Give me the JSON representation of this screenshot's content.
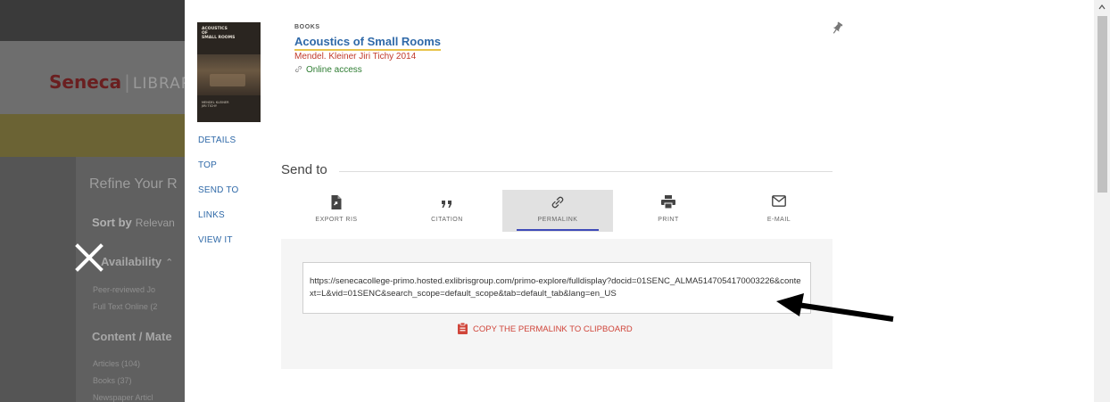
{
  "background": {
    "logo": {
      "brand": "Seneca",
      "separator": "|",
      "library": "LIBRARI"
    },
    "refine_heading": "Refine Your R",
    "sort": {
      "label": "Sort by",
      "value": "Relevan"
    },
    "availability": {
      "heading": "Availability",
      "items": [
        "Peer-reviewed Jo",
        "Full Text Online (2"
      ]
    },
    "content_type": {
      "heading": "Content / Mate",
      "items": [
        "Articles (104)",
        "Books (37)",
        "Newspaper Articl"
      ]
    },
    "close_label": "×"
  },
  "record": {
    "cover": {
      "title_lines": [
        "ACOUSTICS",
        "OF",
        "SMALL ROOMS"
      ],
      "author_lines": [
        "MENDEL KLEINER",
        "JIRI TICHY"
      ]
    },
    "type": "BOOKS",
    "title": "Acoustics of Small Rooms",
    "author_line": "Mendel. Kleiner Jiri Tichy 2014",
    "access": "Online access",
    "side_nav": [
      "DETAILS",
      "TOP",
      "SEND TO",
      "LINKS",
      "VIEW IT"
    ]
  },
  "send_to": {
    "heading": "Send to",
    "tabs": [
      {
        "label": "EXPORT RIS",
        "icon": "export-ris-icon"
      },
      {
        "label": "CITATION",
        "icon": "quote-icon"
      },
      {
        "label": "PERMALINK",
        "icon": "link-icon",
        "active": true
      },
      {
        "label": "PRINT",
        "icon": "printer-icon"
      },
      {
        "label": "E-MAIL",
        "icon": "envelope-icon"
      }
    ],
    "permalink_url": "https://senecacollege-primo.hosted.exlibrisgroup.com/primo-explore/fulldisplay?docid=01SENC_ALMA5147054170003226&context=L&vid=01SENC&search_scope=default_scope&tab=default_tab&lang=en_US",
    "copy_label": "COPY THE PERMALINK TO CLIPBOARD"
  },
  "colors": {
    "link_blue": "#2f69a8",
    "author_red": "#c0392b",
    "access_green": "#2e7d32",
    "active_tab_bar": "#3e4ab8",
    "title_underline": "#e8c44a"
  }
}
